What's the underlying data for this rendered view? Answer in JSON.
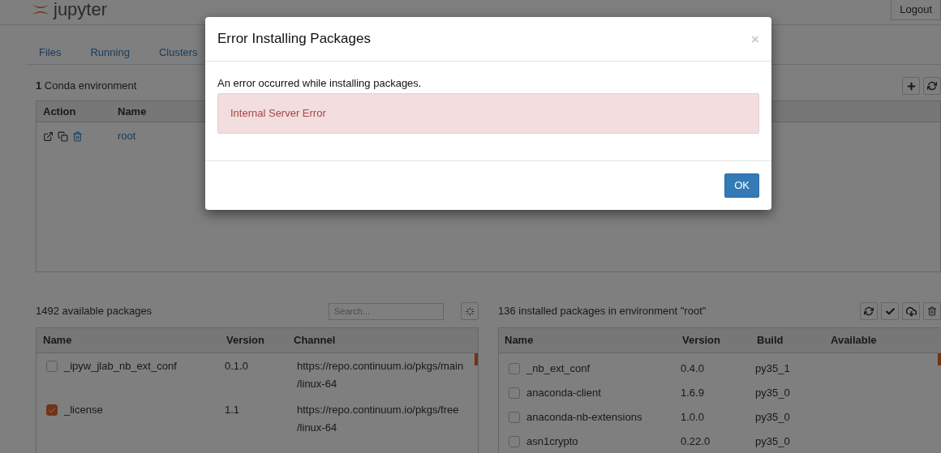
{
  "header": {
    "logo": "jupyter",
    "logout": "Logout"
  },
  "tabs": [
    {
      "label": "Files"
    },
    {
      "label": "Running"
    },
    {
      "label": "Clusters"
    }
  ],
  "environments": {
    "count": "1",
    "label": "Conda environment",
    "columns": [
      "Action",
      "Name"
    ],
    "rows": [
      {
        "name": "root"
      }
    ]
  },
  "available": {
    "count": "1492",
    "label": "available packages",
    "search": {
      "placeholder": "Search..."
    },
    "columns": [
      "Name",
      "Version",
      "Channel"
    ],
    "rows": [
      {
        "name": "_ipyw_jlab_nb_ext_conf",
        "version": "0.1.0",
        "channel": [
          "https://repo.continuum.io/pkgs/main",
          "/linux-64"
        ],
        "checked": false
      },
      {
        "name": "_license",
        "version": "1.1",
        "channel": [
          "https://repo.continuum.io/pkgs/free",
          "/linux-64"
        ],
        "checked": true
      }
    ]
  },
  "installed": {
    "title": "136 installed packages in environment \"root\"",
    "columns": [
      "Name",
      "Version",
      "Build",
      "Available"
    ],
    "rows": [
      {
        "name": "_nb_ext_conf",
        "version": "0.4.0",
        "build": "py35_1",
        "checked": false
      },
      {
        "name": "anaconda-client",
        "version": "1.6.9",
        "build": "py35_0",
        "checked": false
      },
      {
        "name": "anaconda-nb-extensions",
        "version": "1.0.0",
        "build": "py35_0",
        "checked": false
      },
      {
        "name": "asn1crypto",
        "version": "0.22.0",
        "build": "py35_0",
        "checked": false
      }
    ]
  },
  "modal": {
    "title": "Error Installing Packages",
    "close": "×",
    "message": "An error occurred while installing packages.",
    "alert": "Internal Server Error",
    "ok": "OK"
  }
}
